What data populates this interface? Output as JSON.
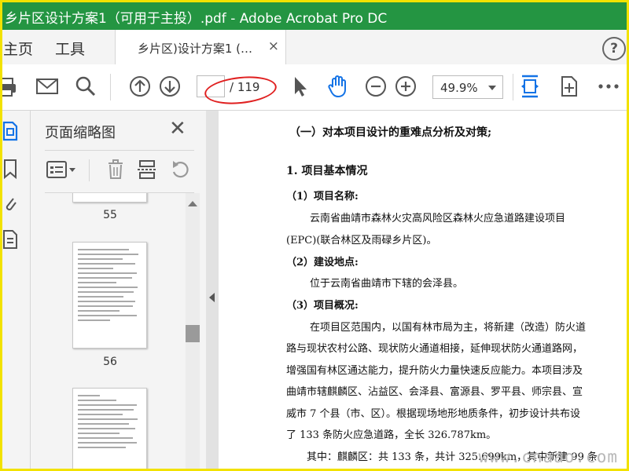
{
  "window": {
    "title": "乡片区设计方案1（可用于主投）.pdf - Adobe Acrobat Pro DC"
  },
  "nav": {
    "home": "主页",
    "tools": "工具"
  },
  "doc_tab": {
    "label": "乡片区)设计方案1 (…",
    "close": "×"
  },
  "help": "?",
  "toolbar": {
    "current_page": "",
    "page_total": "/ 119",
    "zoom": "49.9%"
  },
  "pane": {
    "title": "页面缩略图",
    "close": "✕",
    "thumbnails": [
      {
        "page": "55"
      },
      {
        "page": "56"
      }
    ]
  },
  "document": {
    "heading": "（一）对本项目设计的重难点分析及对策;",
    "section": "1. 项目基本情况",
    "item1_title": "（1）项目名称:",
    "item1_line1": "云南省曲靖市森林火灾高风险区森林火应急道路建设项目",
    "item1_line2": "(EPC)(联合林区及雨碌乡片区)。",
    "item2_title": "（2）建设地点:",
    "item2_line1": "位于云南省曲靖市下辖的会泽县。",
    "item3_title": "（3）项目概况:",
    "p1": "在项目区范围内，以国有林市局为主，将新建（改造）防火道",
    "p2": "路与现状农村公路、现状防火通道相接，延伸现状防火通道路网，",
    "p3": "增强国有林区通达能力，提升防火力量快速反应能力。本项目涉及",
    "p4": "曲靖市辖麒麟区、沾益区、会泽县、富源县、罗平县、师宗县、宣",
    "p5": "威市 7 个县（市、区）。根据现场地形地质条件，初步设计共布设",
    "p6": "了 133 条防火应急道路，全长 326.787km。",
    "p7": "其中：麒麟区：共 133 条，共计 325.699km，其中新建 99 条"
  },
  "watermark": "www.cnaao.com"
}
